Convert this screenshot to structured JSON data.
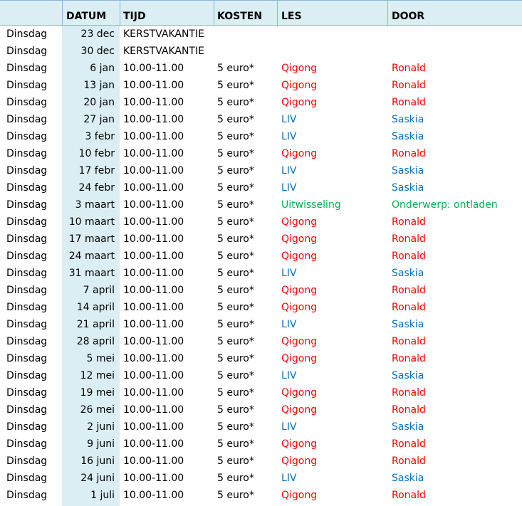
{
  "header": {
    "datum": "DATUM",
    "tijd": "TIJD",
    "kosten": "KOSTEN",
    "les": "LES",
    "door": "DOOR"
  },
  "colors": {
    "header_bg": "#daeef3",
    "date_band": "#daeef3",
    "qigong": "#ff0000",
    "liv": "#0070c0",
    "uitwisseling": "#00b050"
  },
  "rows": [
    {
      "day": "Dinsdag",
      "date": "23 dec",
      "time": "KERSTVAKANTIE",
      "cost": "",
      "les": "",
      "door": "",
      "style": "plain"
    },
    {
      "day": "Dinsdag",
      "date": "30 dec",
      "time": "KERSTVAKANTIE",
      "cost": "",
      "les": "",
      "door": "",
      "style": "plain"
    },
    {
      "day": "Dinsdag",
      "date": "6 jan",
      "time": "10.00-11.00",
      "cost": "5 euro*",
      "les": "Qigong",
      "door": "Ronald",
      "style": "red"
    },
    {
      "day": "Dinsdag",
      "date": "13 jan",
      "time": "10.00-11.00",
      "cost": "5 euro*",
      "les": "Qigong",
      "door": "Ronald",
      "style": "red"
    },
    {
      "day": "Dinsdag",
      "date": "20 jan",
      "time": "10.00-11.00",
      "cost": "5 euro*",
      "les": "Qigong",
      "door": "Ronald",
      "style": "red"
    },
    {
      "day": "Dinsdag",
      "date": "27 jan",
      "time": "10.00-11.00",
      "cost": "5 euro*",
      "les": "LIV",
      "door": "Saskia",
      "style": "blue"
    },
    {
      "day": "Dinsdag",
      "date": "3 febr",
      "time": "10.00-11.00",
      "cost": "5 euro*",
      "les": "LIV",
      "door": "Saskia",
      "style": "blue"
    },
    {
      "day": "Dinsdag",
      "date": "10 febr",
      "time": "10.00-11.00",
      "cost": "5 euro*",
      "les": "Qigong",
      "door": "Ronald",
      "style": "red"
    },
    {
      "day": "Dinsdag",
      "date": "17 febr",
      "time": "10.00-11.00",
      "cost": "5 euro*",
      "les": "LIV",
      "door": "Saskia",
      "style": "blue"
    },
    {
      "day": "Dinsdag",
      "date": "24 febr",
      "time": "10.00-11.00",
      "cost": "5 euro*",
      "les": "LIV",
      "door": "Saskia",
      "style": "blue"
    },
    {
      "day": "Dinsdag",
      "date": "3 maart",
      "time": "10.00-11.00",
      "cost": "5 euro*",
      "les": "Uitwisseling",
      "door": "Onderwerp:  ontladen",
      "style": "green"
    },
    {
      "day": "Dinsdag",
      "date": "10 maart",
      "time": "10.00-11.00",
      "cost": "5 euro*",
      "les": "Qigong",
      "door": "Ronald",
      "style": "red"
    },
    {
      "day": "Dinsdag",
      "date": "17 maart",
      "time": "10.00-11.00",
      "cost": "5 euro*",
      "les": "Qigong",
      "door": "Ronald",
      "style": "red"
    },
    {
      "day": "Dinsdag",
      "date": "24 maart",
      "time": "10.00-11.00",
      "cost": "5 euro*",
      "les": "Qigong",
      "door": "Ronald",
      "style": "red"
    },
    {
      "day": "Dinsdag",
      "date": "31 maart",
      "time": "10.00-11.00",
      "cost": "5 euro*",
      "les": "LIV",
      "door": "Saskia",
      "style": "blue"
    },
    {
      "day": "Dinsdag",
      "date": "7 april",
      "time": "10.00-11.00",
      "cost": "5 euro*",
      "les": "Qigong",
      "door": "Ronald",
      "style": "red"
    },
    {
      "day": "Dinsdag",
      "date": "14 april",
      "time": "10.00-11.00",
      "cost": "5 euro*",
      "les": "Qigong",
      "door": "Ronald",
      "style": "red"
    },
    {
      "day": "Dinsdag",
      "date": "21 april",
      "time": "10.00-11.00",
      "cost": "5 euro*",
      "les": "LIV",
      "door": "Saskia",
      "style": "blue"
    },
    {
      "day": "Dinsdag",
      "date": "28 april",
      "time": "10.00-11.00",
      "cost": "5 euro*",
      "les": "Qigong",
      "door": "Ronald",
      "style": "red"
    },
    {
      "day": "Dinsdag",
      "date": "5 mei",
      "time": "10.00-11.00",
      "cost": "5 euro*",
      "les": "Qigong",
      "door": "Ronald",
      "style": "red"
    },
    {
      "day": "Dinsdag",
      "date": "12 mei",
      "time": "10.00-11.00",
      "cost": "5 euro*",
      "les": "LIV",
      "door": "Saskia",
      "style": "blue"
    },
    {
      "day": "Dinsdag",
      "date": "19 mei",
      "time": "10.00-11.00",
      "cost": "5 euro*",
      "les": "Qigong",
      "door": "Ronald",
      "style": "red"
    },
    {
      "day": "Dinsdag",
      "date": "26 mei",
      "time": "10.00-11.00",
      "cost": "5 euro*",
      "les": "Qigong",
      "door": "Ronald",
      "style": "red"
    },
    {
      "day": "Dinsdag",
      "date": "2 juni",
      "time": "10.00-11.00",
      "cost": "5 euro*",
      "les": "LIV",
      "door": "Saskia",
      "style": "blue"
    },
    {
      "day": "Dinsdag",
      "date": "9 juni",
      "time": "10.00-11.00",
      "cost": "5 euro*",
      "les": "Qigong",
      "door": "Ronald",
      "style": "red"
    },
    {
      "day": "Dinsdag",
      "date": "16 juni",
      "time": "10.00-11.00",
      "cost": "5 euro*",
      "les": "Qigong",
      "door": "Ronald",
      "style": "red"
    },
    {
      "day": "Dinsdag",
      "date": "24 juni",
      "time": "10.00-11.00",
      "cost": "5 euro*",
      "les": "LIV",
      "door": "Saskia",
      "style": "blue"
    },
    {
      "day": "Dinsdag",
      "date": "1 juli",
      "time": "10.00-11.00",
      "cost": "5 euro*",
      "les": "Qigong",
      "door": "Ronald",
      "style": "red"
    }
  ]
}
